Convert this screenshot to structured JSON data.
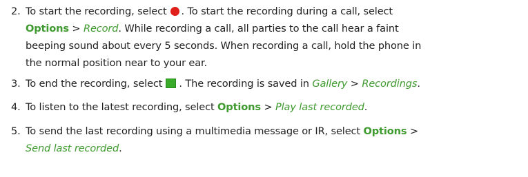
{
  "steps": [
    {
      "number": "2.",
      "lines": [
        {
          "a": "To start the recording, select",
          "b": ". To start the recording during a call, select"
        },
        {
          "options": "Options",
          "sep": " > ",
          "record": "Record",
          "rest": ". While recording a call, all parties to the call hear a faint"
        },
        {
          "text": "beeping sound about every 5 seconds. When recording a call, hold the phone in"
        },
        {
          "text": "the normal position near to your ear."
        }
      ]
    },
    {
      "number": "3.",
      "a": "To end the recording, select",
      "b": ". The recording is saved in",
      "gallery": "Gallery",
      "sep": " > ",
      "recordings": "Recordings",
      "end": "."
    },
    {
      "number": "4.",
      "a": "To listen to the latest recording, select",
      "options": "Options",
      "sep": " > ",
      "item": "Play last recorded",
      "end": "."
    },
    {
      "number": "5.",
      "a": "To send the last recording using a multimedia message or IR, select",
      "options": "Options",
      "sep": " >",
      "item": "Send last recorded",
      "end": "."
    }
  ],
  "icons": {
    "record": "record-icon",
    "stop": "stop-icon"
  },
  "colors": {
    "accent_green": "#3f9a2f",
    "record_red": "#e0201a",
    "stop_green": "#3aaa2a",
    "text": "#222222"
  }
}
